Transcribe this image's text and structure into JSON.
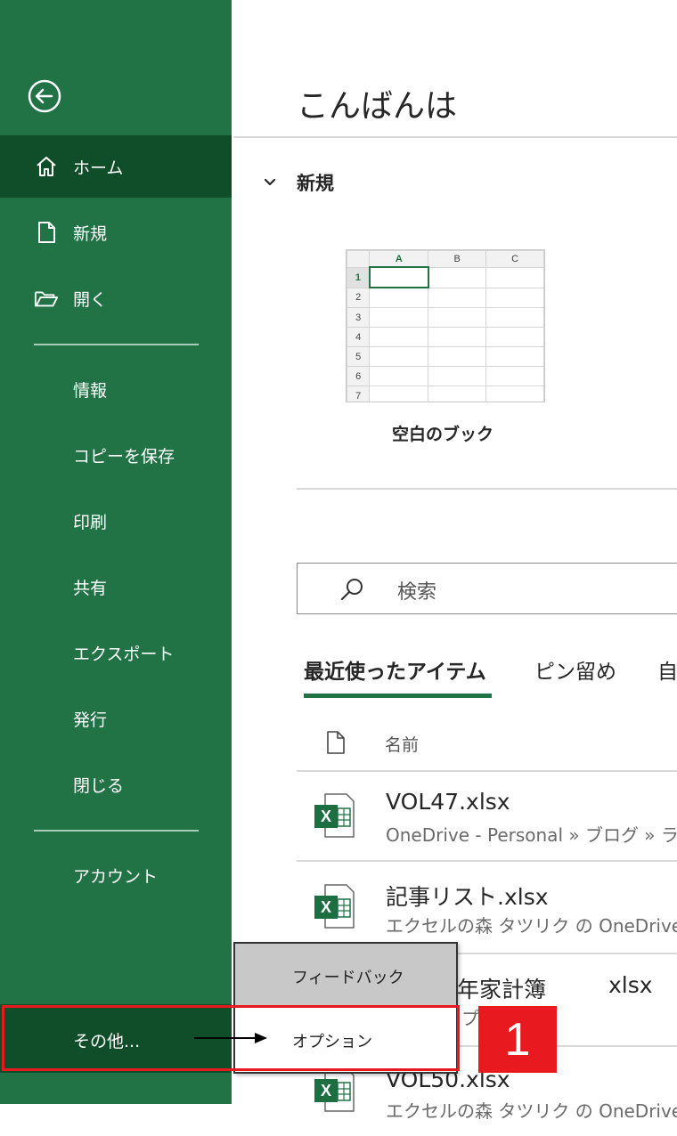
{
  "sidebar": {
    "items": [
      {
        "label": "ホーム",
        "icon": "home-icon"
      },
      {
        "label": "新規",
        "icon": "new-document-icon"
      },
      {
        "label": "開く",
        "icon": "folder-open-icon"
      },
      {
        "label": "情報"
      },
      {
        "label": "コピーを保存"
      },
      {
        "label": "印刷"
      },
      {
        "label": "共有"
      },
      {
        "label": "エクスポート"
      },
      {
        "label": "発行"
      },
      {
        "label": "閉じる"
      },
      {
        "label": "アカウント"
      }
    ],
    "other_label": "その他...",
    "accent": "#217346",
    "selected_bg": "#0f4e29"
  },
  "flyout": {
    "items": [
      {
        "label": "フィードバック"
      },
      {
        "label": "オプション"
      }
    ]
  },
  "annotation": {
    "step_number": "1",
    "color": "#e8191f"
  },
  "main": {
    "greeting": "こんばんは",
    "new_section": {
      "title": "新規",
      "template_label": "空白のブック",
      "thumb_columns": [
        "A",
        "B",
        "C"
      ],
      "thumb_rows": [
        "1",
        "2",
        "3",
        "4",
        "5",
        "6",
        "7"
      ]
    },
    "search": {
      "placeholder": "検索"
    },
    "tabs": [
      {
        "label": "最近使ったアイテム",
        "active": true
      },
      {
        "label": "ピン留め"
      },
      {
        "label": "自"
      }
    ],
    "file_list": {
      "name_header": "名前",
      "files": [
        {
          "name": "VOL47.xlsx",
          "path": "OneDrive - Personal » ブログ » ラ"
        },
        {
          "name": "記事リスト.xlsx",
          "path": "エクセルの森 タツリク の OneDrive »"
        },
        {
          "name": "年家計簿",
          "ext": "xlsx",
          "path": "プ"
        },
        {
          "name": "VOL50.xlsx",
          "path": "エクセルの森 タツリク の OneDrive »"
        }
      ]
    }
  }
}
